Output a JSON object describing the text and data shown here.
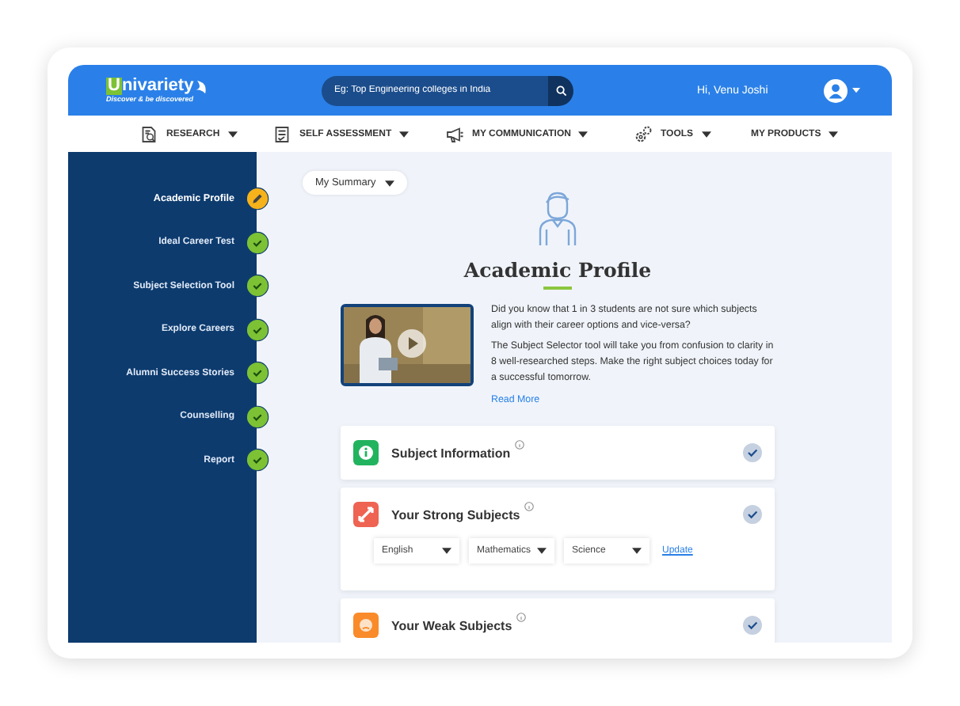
{
  "header": {
    "logo": {
      "mark": "U",
      "name": "nivariety",
      "tagline": "Discover & be discovered"
    },
    "search": {
      "placeholder": "Eg: Top Engineering colleges in India"
    },
    "greeting": "Hi, Venu Joshi"
  },
  "nav": [
    {
      "label": "RESEARCH"
    },
    {
      "label": "SELF ASSESSMENT"
    },
    {
      "label": "MY COMMUNICATION"
    },
    {
      "label": "TOOLS"
    },
    {
      "label": "MY PRODUCTS"
    }
  ],
  "sidebar": {
    "items": [
      {
        "label": "Academic Profile",
        "selected": true,
        "kind": "editing"
      },
      {
        "label": "Ideal Career Test",
        "selected": false,
        "kind": "done"
      },
      {
        "label": "Subject Selection Tool",
        "selected": false,
        "kind": "done"
      },
      {
        "label": "Explore Careers",
        "selected": false,
        "kind": "done"
      },
      {
        "label": "Alumni Success Stories",
        "selected": false,
        "kind": "done"
      },
      {
        "label": "Counselling",
        "selected": false,
        "kind": "done"
      },
      {
        "label": "Report",
        "selected": false,
        "kind": "done"
      }
    ]
  },
  "summary_dropdown": {
    "value": "My Summary"
  },
  "intro": {
    "title": "Academic Profile",
    "video": {
      "kind": "picture"
    },
    "paragraphs": [
      "Did you know that 1 in 3 students are not sure which subjects align with their career options and vice-versa?",
      "The Subject Selector tool will take you from confusion to clarity in 8 well-researched steps. Make the right subject choices today for a successful tomorrow."
    ],
    "link": "Read More"
  },
  "sections": [
    {
      "kind": "info",
      "title": "Subject Information",
      "color": "#22b35e",
      "completed": true
    },
    {
      "kind": "strong",
      "title": "Your Strong Subjects",
      "color": "#ee6352",
      "completed": true,
      "subjects": [
        {
          "value": "English"
        },
        {
          "value": "Mathematics"
        },
        {
          "value": "Science"
        }
      ],
      "action": "Update"
    },
    {
      "kind": "weak",
      "title": "Your Weak Subjects",
      "color": "#f98b2a",
      "completed": true
    }
  ]
}
